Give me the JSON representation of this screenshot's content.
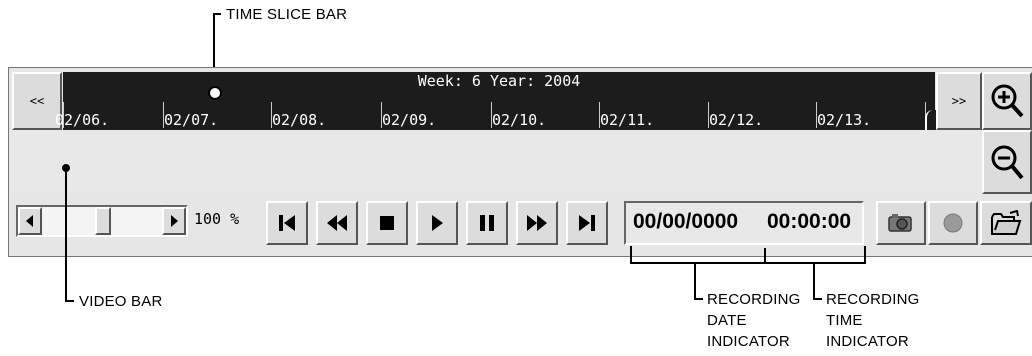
{
  "callouts": {
    "time_slice_bar": "TIME SLICE BAR",
    "video_bar": "VIDEO BAR",
    "recording_date": [
      "RECORDING",
      "DATE",
      "INDICATOR"
    ],
    "recording_time": [
      "RECORDING",
      "TIME",
      "INDICATOR"
    ]
  },
  "timeline": {
    "prev_label": "<<",
    "next_label": ">>",
    "week_label": "Week: 6 Year: 2004",
    "dates": [
      "02/06.",
      "02/07.",
      "02/08.",
      "02/09.",
      "02/10.",
      "02/11.",
      "02/12.",
      "02/13."
    ]
  },
  "zoom": {
    "percent_label": "100 %",
    "level_fraction": 0.5
  },
  "indicators": {
    "date": "00/00/0000",
    "time": "00:00:00"
  },
  "icons": [
    "zoom-in-icon",
    "zoom-out-icon",
    "skip-start-icon",
    "rewind-icon",
    "stop-icon",
    "play-icon",
    "pause-icon",
    "fast-forward-icon",
    "skip-end-icon",
    "camera-icon",
    "record-icon",
    "open-folder-icon"
  ]
}
